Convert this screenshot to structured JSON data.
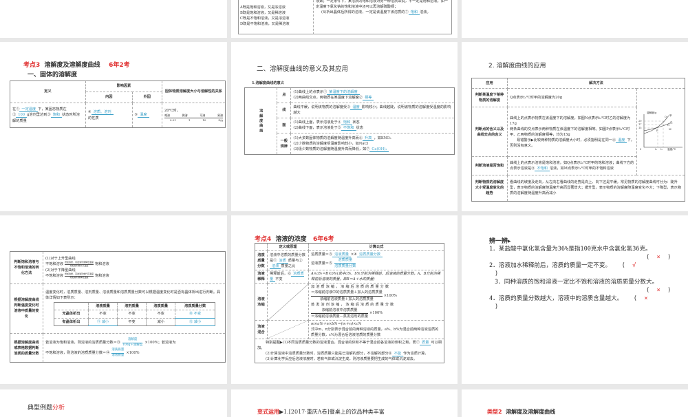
{
  "slides": {
    "top_mid": {
      "options": [
        "A既是饱和溶液，又是浓溶液",
        "B既是饱和溶液，又是稀溶液",
        "C既是不饱和溶液，又是浓溶液",
        "D既是不饱和溶液，又是稀溶液"
      ],
      "text1": "液数；一定条件下，某溶质的饱和溶液对另一种溶质来说，不一定是饱和溶液。如一定温度下氯化钠的饱和溶液中还可以再溶解硫酸铜；",
      "text2": "(4)析出晶体后所得的溶液，一定是该温度下该溶质的⑦",
      "ans": "饱和",
      "text3": "溶液。"
    },
    "s1": {
      "title_a": "考点3",
      "title_b": "溶解度及溶解度曲线",
      "title_c": "6年2考",
      "subtitle": "一、固体的溶解度",
      "h_def": "定义",
      "h_factor": "影响因素",
      "h_inner": "内因",
      "h_outer": "外因",
      "h_rel": "固体物质溶解度大小与溶解性的关系",
      "def_1": "在①",
      "def_a1": "一定温度",
      "def_2": "下，某固态物质在②",
      "def_a2": "100",
      "def_3": "g溶剂里达到③",
      "def_a3": "饱和",
      "def_4": "状态时所溶解的质量",
      "inner_1": "④",
      "inner_a": "溶质、溶剂",
      "inner_2": "的性质",
      "outer_1": "⑤",
      "outer_a": "温度",
      "rel_title": "20℃时，",
      "scale": [
        "难溶",
        "微溶",
        "可溶",
        "易溶"
      ],
      "ticks": [
        "0.01",
        "1",
        "10",
        "S/g"
      ]
    },
    "s2": {
      "title": "二、溶解度曲线的意义及其应用",
      "label": "1.溶解度曲线的意义",
      "side": "溶解度曲线",
      "rows": [
        {
          "k": "点",
          "l": [
            "(1)曲线上的点表示①",
            "(2)两曲线交点，两物质在某温度下溶解度②"
          ],
          "a": [
            "某温度下的溶解度",
            "相等"
          ]
        },
        {
          "k": "线",
          "pre": "曲线平缓，说明该物质的溶解度受③",
          "a": "温度",
          "post": "影响较小；曲线越陡，说明该物质的溶解度受温度的影响越大"
        },
        {
          "k": "面",
          "l": [
            "(1)曲线上面，表示溶液处于④",
            "(2)曲线下面，表示溶液处于⑤"
          ],
          "a": [
            "饱和",
            "不饱和"
          ],
          "s": "状态"
        },
        {
          "k": "一般规律",
          "l": [
            "(1)大多数固体物质的溶解度随温度升高而⑥",
            "(2)少数物质的溶解度受温度影响较小，如NaCl",
            "(3)极少数物质的溶解度随温度升高而降低，如⑦"
          ],
          "a": [
            "升高",
            "Ca(OH)₂"
          ],
          "s": "，如KNO₃"
        }
      ]
    },
    "s3": {
      "title": "2. 溶解度曲线的应用",
      "h_app": "应用",
      "h_method": "解决方法",
      "r1k": "判断某温度下某种物质的溶解度",
      "r1": "Q点表示t₁℃时甲的溶解度为20g",
      "r2k": "判断点的含义以及曲线交点的含义",
      "r2a": "曲线上的点表示物质在该温度下的溶解度。如图N点表示t₂℃时乙的溶解度为17g",
      "r2b": "两条曲线的交点表示两种物质在该温度下的溶解度相等。如图P点表示t₁℃时甲、乙两物质的溶解度相等，均为15g",
      "r2c": "易错警示▶比较两种物质的溶解度大小时，必须指明是在同一⑧",
      "r2ans": "温度",
      "r2d": "下，否则没有意义。",
      "r3k": "判断溶液是否饱和",
      "r3a": "曲线上的点表示溶液是饱和溶液，如Q点表示t₁℃时甲的饱和溶液；曲线下方的点表示溶液是⑨",
      "r3ans": "不饱和",
      "r3b": "溶液，如M点表示t₁℃时甲的不饱和溶液",
      "r4k": "判断物质的溶解度大小受温度变化的趋势",
      "r4": "看曲线的坡度及走向，从左向右看曲线的走势是向上、向下还是平缓。常见物质的溶解度曲线可分为：陡升型，表示物质的溶解度随温度升高而显著增大；缓升型，表示物质的溶解度随温度变化不大；下降型，表示物质的溶解度随温度升高而减小",
      "graph": {
        "ylabel": "溶解度/g",
        "xlabel": "温度/℃",
        "y": [
          "20",
          "17",
          "15"
        ],
        "x": [
          "0",
          "t₁",
          "t₂"
        ],
        "curves": [
          "甲",
          "乙"
        ],
        "points": [
          "Q",
          "P",
          "N",
          "M"
        ]
      }
    },
    "s4": {
      "r1k": "判断饱和溶液与不饱和溶液的转化方法",
      "r1a": "(1)对于上升型曲线",
      "r1b": "(2)对于下降型曲线",
      "unsat": "不饱和溶液",
      "sat": "饱和溶液",
      "arr1t": "增加溶质、蒸发溶剂或降低温度",
      "arr1b": "增加溶剂或升高温度",
      "arr2t": "增加溶质、蒸发溶剂或升高温度",
      "arr2b": "增加溶剂或降低温度",
      "r2k": "根据溶解度曲线判断温度变化时溶液中质量的变化",
      "r2": "温度变化时，溶质质量、溶剂质量、溶液质量和溶质质量分数可以根据温度变化时是否有晶体析出进行判断。具体详情如下表所示：",
      "cols": [
        "",
        "溶液质量",
        "溶剂质量",
        "溶质质量",
        "溶质质量分数"
      ],
      "rows": [
        [
          "无晶体析出",
          "不变",
          "不变",
          "不变",
          "⑩ 不变"
        ],
        [
          "有晶体析出",
          "⑪ 减小",
          "不变",
          "减小",
          "⑫ 减小"
        ]
      ],
      "r3k": "根据溶解度曲线或表格数据判断溶质的质量分数",
      "r3a": "若溶液为饱和溶液，则溶液的溶质质量分数＝⑬",
      "r3a_num": "溶解度",
      "r3a_den": "100g＋溶解度",
      "r3a_post": "×100%；若溶液为",
      "r3b": "不饱和溶液，则溶液的溶质质量分数＝⑭",
      "r3b_num": "溶质质量",
      "r3b_den": "溶液质量",
      "r3b_post": "×100%"
    },
    "s5": {
      "title_a": "考点4",
      "title_b": "溶液的浓度",
      "title_c": "6年6考",
      "h1": "定义或原理",
      "h2": "计算公式",
      "k1": "溶质质量分数",
      "d1a": "溶液中溶质的质量分数是①",
      "d1ans1": "溶质",
      "d1b": "质量与②",
      "d1ans2": "溶液",
      "d1c": "质量之比",
      "f1a": "溶质质量＝③",
      "f1ans1": "溶液质量",
      "f1b": "×④",
      "f1ans2": "溶质质量分数",
      "f2a": "溶液质量＝⑤",
      "f2num": "溶质质量",
      "f2den": "溶质质量分数",
      "k2": "溶液稀释",
      "d2a": "稀释前后，⑥",
      "d2ans": "溶质质量",
      "d2b": "不变",
      "f3": "A×a%＝B×b%(其中a%、b%分别为稀释前、后溶液的质量分数，A、B分别为稀释前后溶液的质量，即B＝A＋水的质量)",
      "k3": "溶液浓缩",
      "f4a": "加溶质浓缩，浓缩后溶质的质量分数",
      "f4num": "＝浓缩前溶液中的溶质质量＋加入的溶质质量",
      "f4den": "浓缩前溶液质量＋加入的溶质质量",
      "f5a": "蒸发溶剂浓缩，浓缩后溶质的质量分数",
      "f5num": "浓缩前溶液中溶质质量",
      "f5den": "＝浓缩前溶液质量－蒸发溶剂的质量",
      "pct": "×100%",
      "k4": "溶液混合",
      "f6a": "m×a%＋n×b%＝(m＋n)×c%",
      "f6b": "式中m、n分别表示混合前的两种溶液的质量，a%、b%为混合前两种溶液溶质的质量分数，c%为混合后溶液溶质的质量分数",
      "note1": "特别提醒▶(1)不同溶质质量分数的溶液混合，混合液的体积不等于混合前各溶液的体积之和，而⑦",
      "note1ans": "质量",
      "note1b": "可以相加。",
      "note2": "(2)计算溶液中溶质质量分数时，溶质质量只能是已溶解的部分，不溶解的部分⑧",
      "note2ans": "不能",
      "note2b": "作为溶质计算。",
      "note3": "(3)计算化学反应后溶液浓度时，若有气体或沉淀生成，则溶液质量要把生成的气体或沉淀减去。"
    },
    "s6": {
      "title": "辨一辨▸",
      "items": [
        {
          "text": "1．某盐酸中氯化氢含量为36%是指100克水中含氯化氢36克。",
          "mark": "×"
        },
        {
          "text": "2．溶液加水稀释前后，溶质的质量一定不变。",
          "mark": "√"
        },
        {
          "text": "3．同种溶质的饱和溶液一定比不饱和溶液的溶质质量分数大。",
          "mark": "×"
        },
        {
          "text": "4．溶质的质量分数越大，溶液中的溶质含量越大。",
          "mark": "×"
        }
      ],
      "open": "(",
      "close": ")"
    },
    "s7": {
      "title_a": "典型例题",
      "title_b": "分析"
    },
    "s8": {
      "title_a": "变式运用",
      "title_b": "▶1.[2017·重庆A卷]餐桌上的饮品种类丰富"
    },
    "s9": {
      "title_a": "类型2",
      "title_b": "溶解度及溶解度曲线"
    }
  },
  "colors": {
    "accent_red": "#e03030",
    "answer_blue": "#3aa0c8",
    "background": "#e8e8e8"
  }
}
